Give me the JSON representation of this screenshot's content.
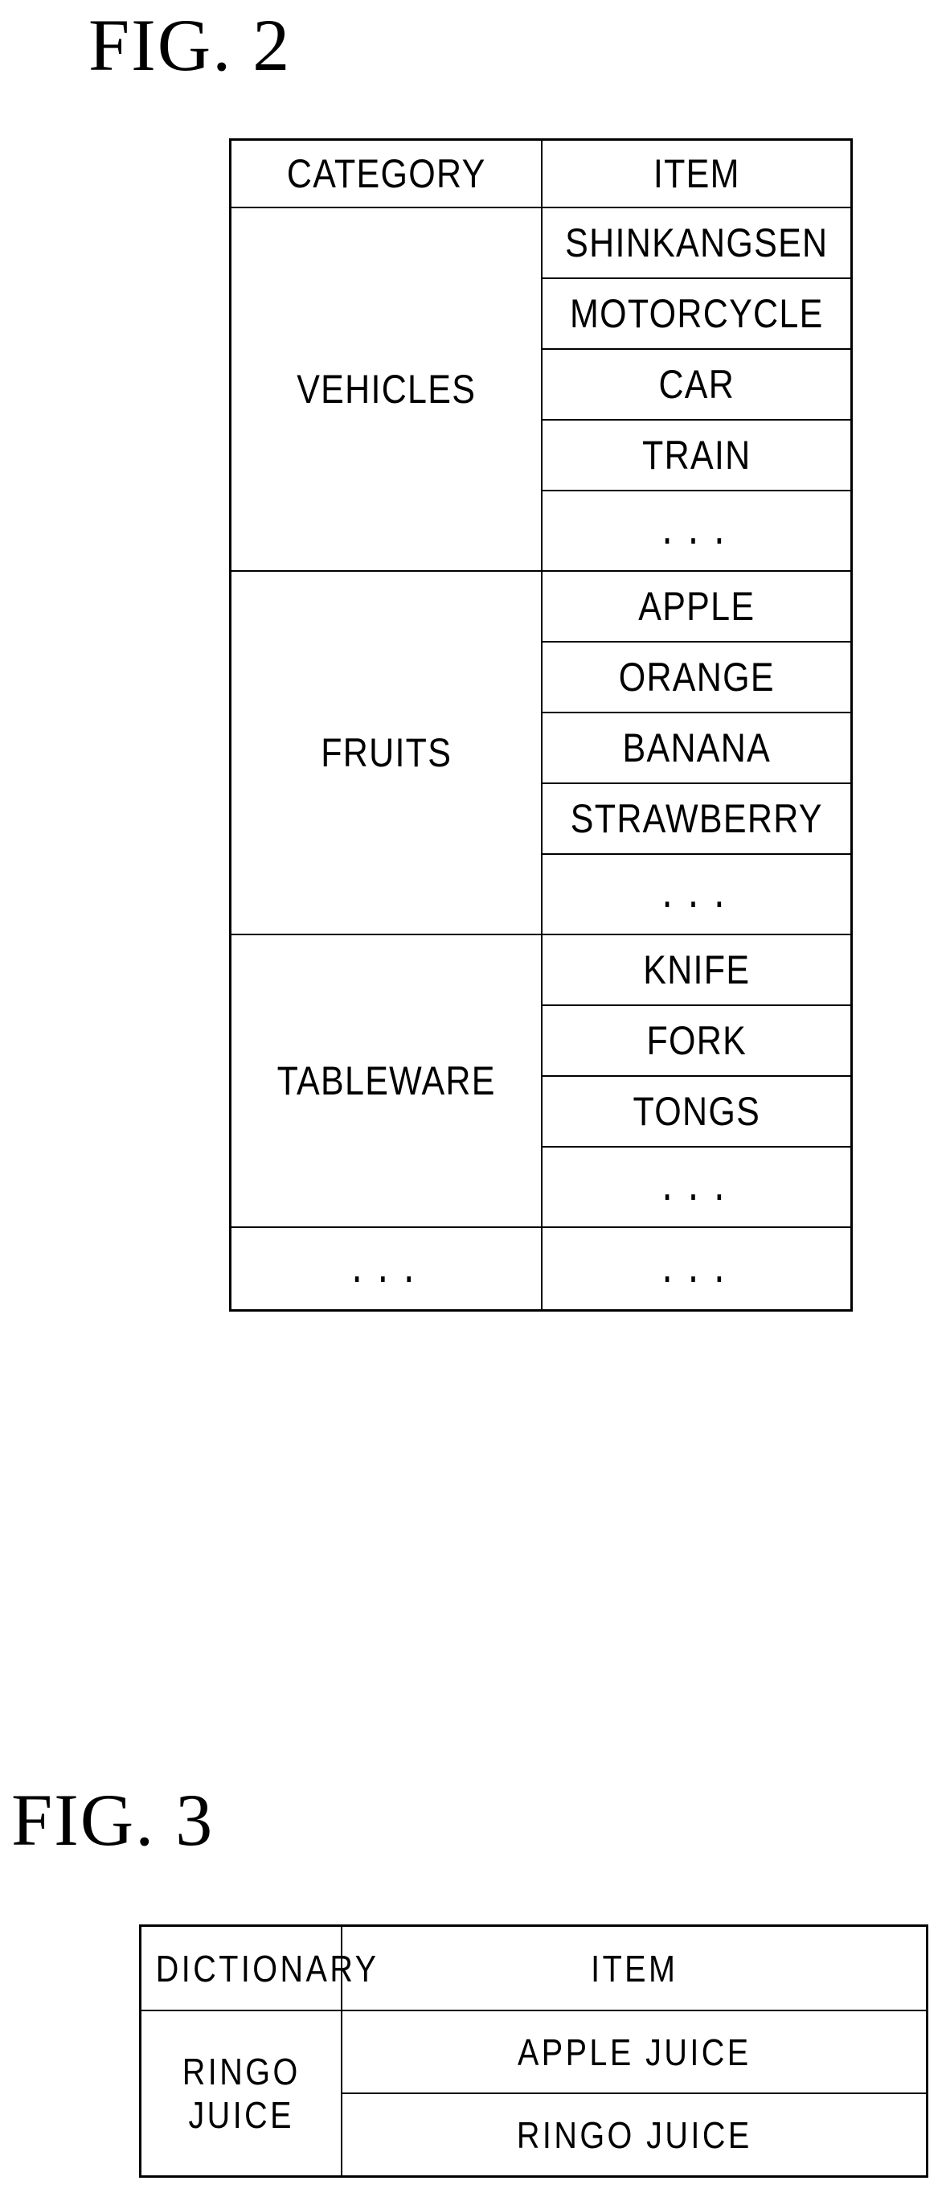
{
  "figures": [
    {
      "caption": "FIG. 2",
      "table": {
        "headers": [
          "CATEGORY",
          "ITEM"
        ],
        "groups": [
          {
            "category": "VEHICLES",
            "items": [
              "SHINKANGSEN",
              "MOTORCYCLE",
              "CAR",
              "TRAIN",
              "..."
            ]
          },
          {
            "category": "FRUITS",
            "items": [
              "APPLE",
              "ORANGE",
              "BANANA",
              "STRAWBERRY",
              "..."
            ]
          },
          {
            "category": "TABLEWARE",
            "items": [
              "KNIFE",
              "FORK",
              "TONGS",
              "..."
            ]
          },
          {
            "category": "...",
            "items": [
              "..."
            ]
          }
        ]
      }
    },
    {
      "caption": "FIG. 3",
      "table": {
        "headers": [
          "DICTIONARY",
          "ITEM"
        ],
        "groups": [
          {
            "category": "RINGO JUICE",
            "items": [
              "APPLE JUICE",
              "RINGO JUICE"
            ]
          }
        ]
      }
    }
  ],
  "style": {
    "line_color": "#000000",
    "text_color": "#000000",
    "background_color": "#ffffff"
  }
}
